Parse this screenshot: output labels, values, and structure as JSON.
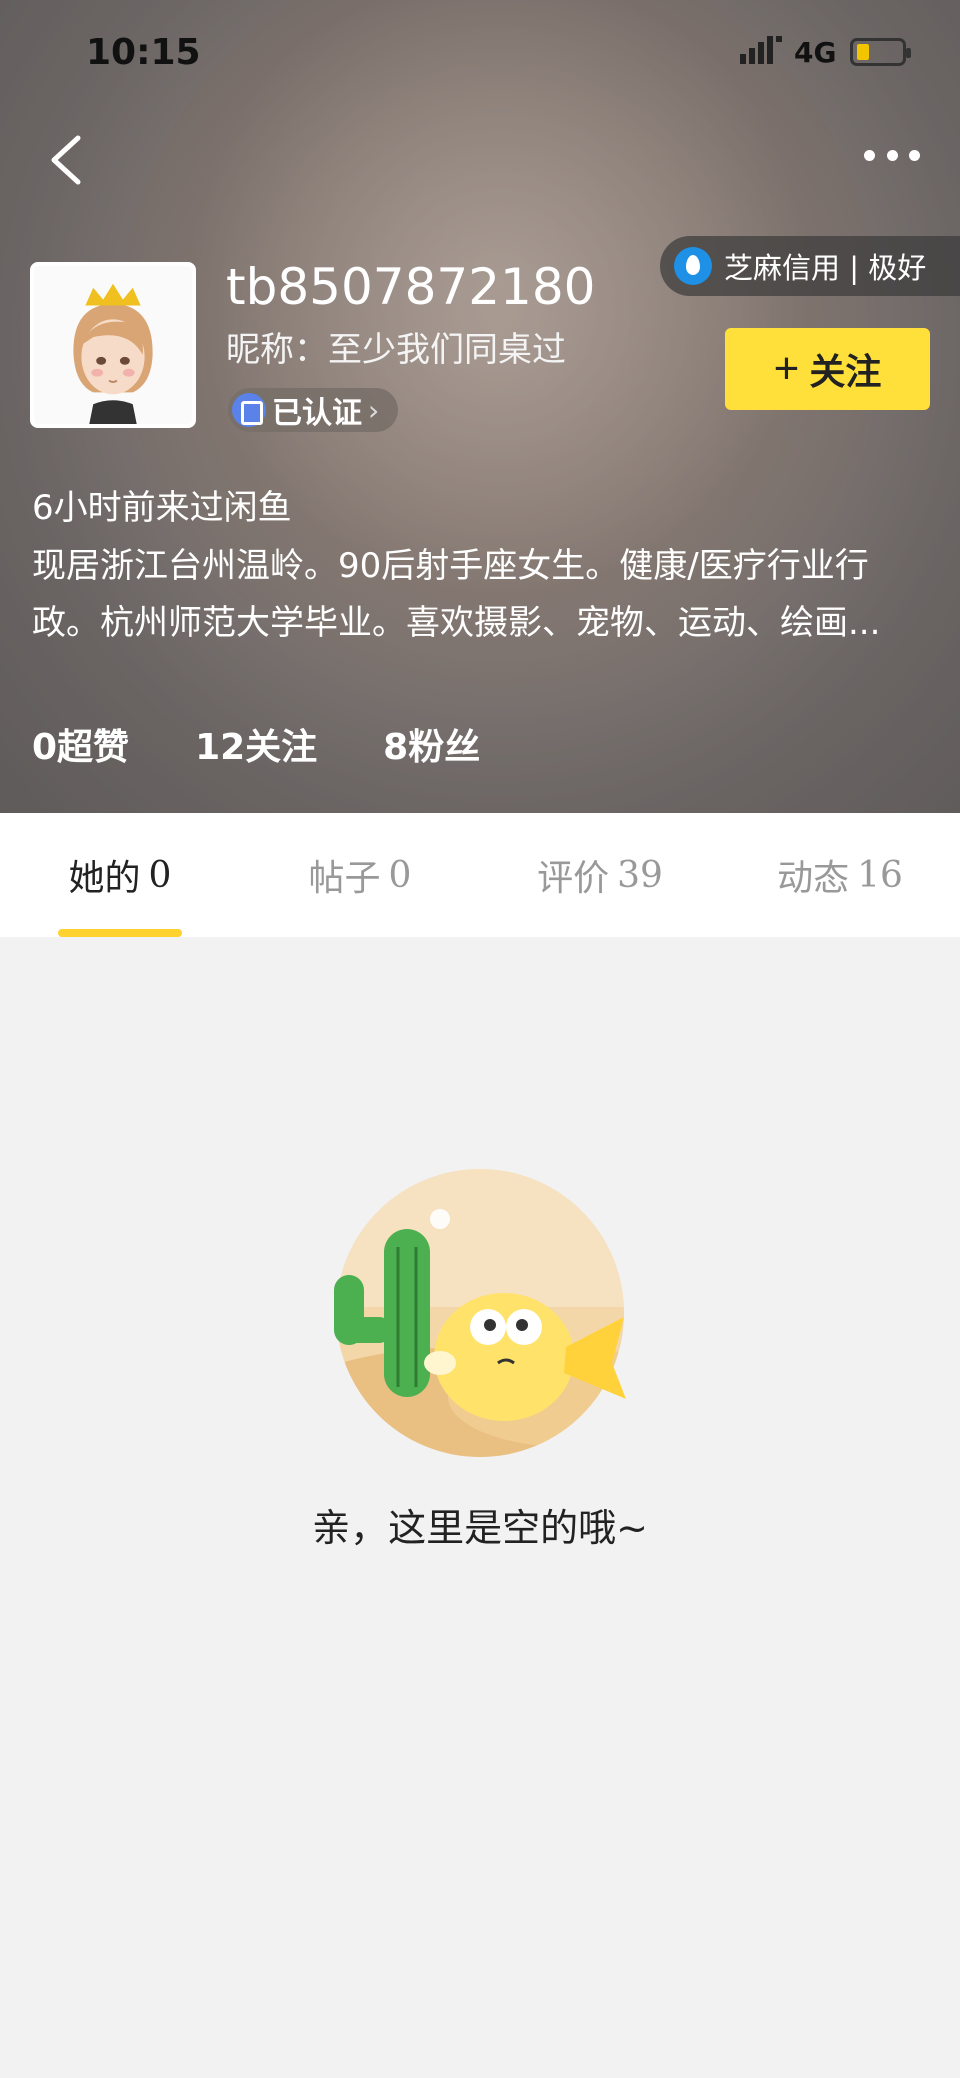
{
  "status_bar": {
    "time": "10:15",
    "network": "4G"
  },
  "profile": {
    "username": "tb8507872180",
    "nickname": "昵称：至少我们同桌过",
    "verified_label": "已认证",
    "credit": "芝麻信用 | 极好",
    "follow_label": "关注",
    "last_seen": "6小时前来过闲鱼",
    "bio": "现居浙江台州温岭。90后射手座女生。健康/医疗行业行政。杭州师范大学毕业。喜欢摄影、宠物、运动、绘画..."
  },
  "stats": [
    {
      "label": "0超赞"
    },
    {
      "label": "12关注"
    },
    {
      "label": "8粉丝"
    }
  ],
  "tabs": [
    {
      "label": "她的",
      "count": "0"
    },
    {
      "label": "帖子",
      "count": "0"
    },
    {
      "label": "评价",
      "count": "39"
    },
    {
      "label": "动态",
      "count": "16"
    }
  ],
  "empty_message": "亲，这里是空的哦~",
  "colors": {
    "accent": "#ffe03a",
    "tab_indicator": "#ffd22e",
    "credit_blue": "#1e90e6"
  }
}
